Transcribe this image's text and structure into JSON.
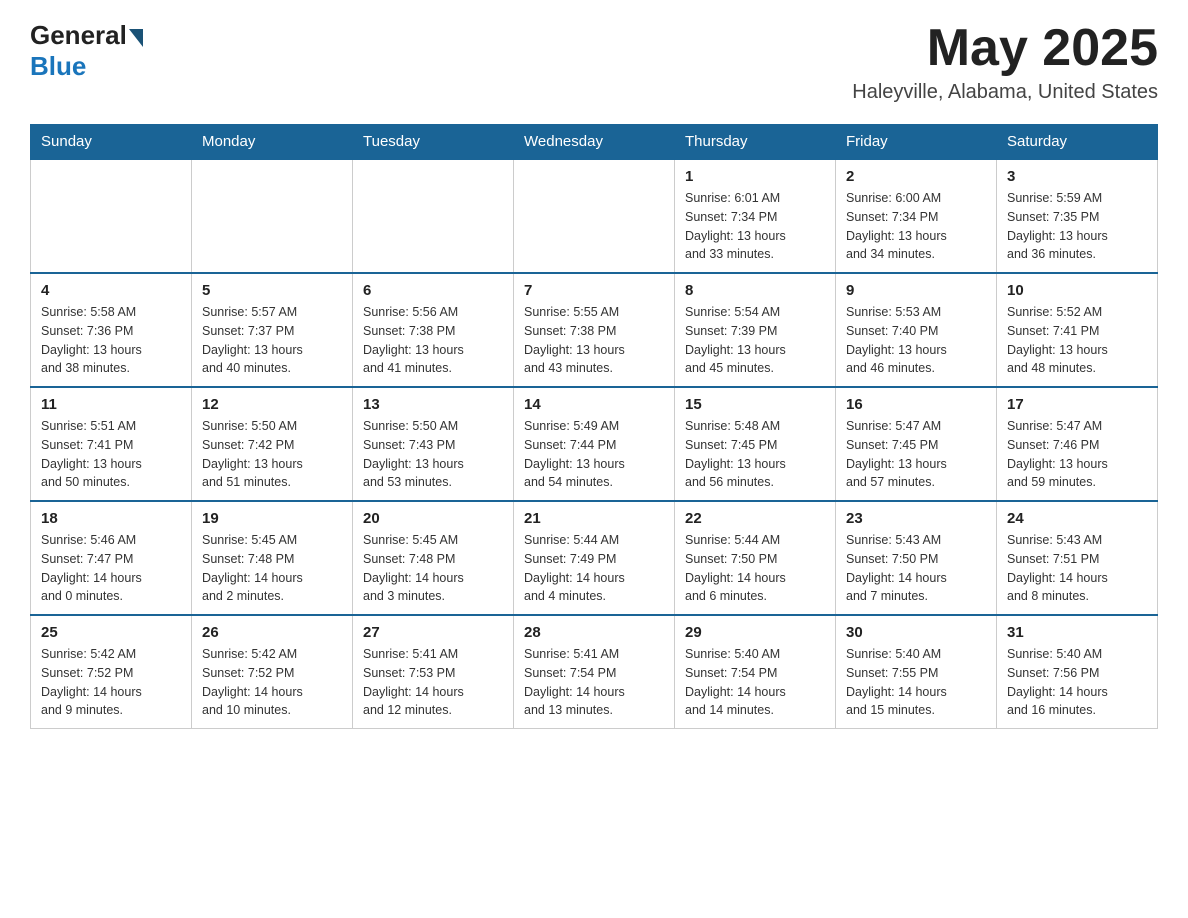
{
  "header": {
    "logo_general": "General",
    "logo_blue": "Blue",
    "month_year": "May 2025",
    "location": "Haleyville, Alabama, United States"
  },
  "days_of_week": [
    "Sunday",
    "Monday",
    "Tuesday",
    "Wednesday",
    "Thursday",
    "Friday",
    "Saturday"
  ],
  "weeks": [
    [
      {
        "day": "",
        "info": ""
      },
      {
        "day": "",
        "info": ""
      },
      {
        "day": "",
        "info": ""
      },
      {
        "day": "",
        "info": ""
      },
      {
        "day": "1",
        "info": "Sunrise: 6:01 AM\nSunset: 7:34 PM\nDaylight: 13 hours\nand 33 minutes."
      },
      {
        "day": "2",
        "info": "Sunrise: 6:00 AM\nSunset: 7:34 PM\nDaylight: 13 hours\nand 34 minutes."
      },
      {
        "day": "3",
        "info": "Sunrise: 5:59 AM\nSunset: 7:35 PM\nDaylight: 13 hours\nand 36 minutes."
      }
    ],
    [
      {
        "day": "4",
        "info": "Sunrise: 5:58 AM\nSunset: 7:36 PM\nDaylight: 13 hours\nand 38 minutes."
      },
      {
        "day": "5",
        "info": "Sunrise: 5:57 AM\nSunset: 7:37 PM\nDaylight: 13 hours\nand 40 minutes."
      },
      {
        "day": "6",
        "info": "Sunrise: 5:56 AM\nSunset: 7:38 PM\nDaylight: 13 hours\nand 41 minutes."
      },
      {
        "day": "7",
        "info": "Sunrise: 5:55 AM\nSunset: 7:38 PM\nDaylight: 13 hours\nand 43 minutes."
      },
      {
        "day": "8",
        "info": "Sunrise: 5:54 AM\nSunset: 7:39 PM\nDaylight: 13 hours\nand 45 minutes."
      },
      {
        "day": "9",
        "info": "Sunrise: 5:53 AM\nSunset: 7:40 PM\nDaylight: 13 hours\nand 46 minutes."
      },
      {
        "day": "10",
        "info": "Sunrise: 5:52 AM\nSunset: 7:41 PM\nDaylight: 13 hours\nand 48 minutes."
      }
    ],
    [
      {
        "day": "11",
        "info": "Sunrise: 5:51 AM\nSunset: 7:41 PM\nDaylight: 13 hours\nand 50 minutes."
      },
      {
        "day": "12",
        "info": "Sunrise: 5:50 AM\nSunset: 7:42 PM\nDaylight: 13 hours\nand 51 minutes."
      },
      {
        "day": "13",
        "info": "Sunrise: 5:50 AM\nSunset: 7:43 PM\nDaylight: 13 hours\nand 53 minutes."
      },
      {
        "day": "14",
        "info": "Sunrise: 5:49 AM\nSunset: 7:44 PM\nDaylight: 13 hours\nand 54 minutes."
      },
      {
        "day": "15",
        "info": "Sunrise: 5:48 AM\nSunset: 7:45 PM\nDaylight: 13 hours\nand 56 minutes."
      },
      {
        "day": "16",
        "info": "Sunrise: 5:47 AM\nSunset: 7:45 PM\nDaylight: 13 hours\nand 57 minutes."
      },
      {
        "day": "17",
        "info": "Sunrise: 5:47 AM\nSunset: 7:46 PM\nDaylight: 13 hours\nand 59 minutes."
      }
    ],
    [
      {
        "day": "18",
        "info": "Sunrise: 5:46 AM\nSunset: 7:47 PM\nDaylight: 14 hours\nand 0 minutes."
      },
      {
        "day": "19",
        "info": "Sunrise: 5:45 AM\nSunset: 7:48 PM\nDaylight: 14 hours\nand 2 minutes."
      },
      {
        "day": "20",
        "info": "Sunrise: 5:45 AM\nSunset: 7:48 PM\nDaylight: 14 hours\nand 3 minutes."
      },
      {
        "day": "21",
        "info": "Sunrise: 5:44 AM\nSunset: 7:49 PM\nDaylight: 14 hours\nand 4 minutes."
      },
      {
        "day": "22",
        "info": "Sunrise: 5:44 AM\nSunset: 7:50 PM\nDaylight: 14 hours\nand 6 minutes."
      },
      {
        "day": "23",
        "info": "Sunrise: 5:43 AM\nSunset: 7:50 PM\nDaylight: 14 hours\nand 7 minutes."
      },
      {
        "day": "24",
        "info": "Sunrise: 5:43 AM\nSunset: 7:51 PM\nDaylight: 14 hours\nand 8 minutes."
      }
    ],
    [
      {
        "day": "25",
        "info": "Sunrise: 5:42 AM\nSunset: 7:52 PM\nDaylight: 14 hours\nand 9 minutes."
      },
      {
        "day": "26",
        "info": "Sunrise: 5:42 AM\nSunset: 7:52 PM\nDaylight: 14 hours\nand 10 minutes."
      },
      {
        "day": "27",
        "info": "Sunrise: 5:41 AM\nSunset: 7:53 PM\nDaylight: 14 hours\nand 12 minutes."
      },
      {
        "day": "28",
        "info": "Sunrise: 5:41 AM\nSunset: 7:54 PM\nDaylight: 14 hours\nand 13 minutes."
      },
      {
        "day": "29",
        "info": "Sunrise: 5:40 AM\nSunset: 7:54 PM\nDaylight: 14 hours\nand 14 minutes."
      },
      {
        "day": "30",
        "info": "Sunrise: 5:40 AM\nSunset: 7:55 PM\nDaylight: 14 hours\nand 15 minutes."
      },
      {
        "day": "31",
        "info": "Sunrise: 5:40 AM\nSunset: 7:56 PM\nDaylight: 14 hours\nand 16 minutes."
      }
    ]
  ]
}
